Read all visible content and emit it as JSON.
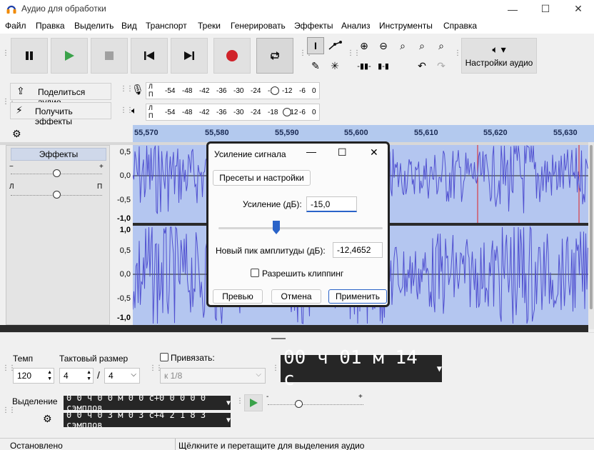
{
  "window": {
    "title": "Аудио для обработки",
    "min_icon": "minimize-icon",
    "max_icon": "maximize-icon",
    "close_icon": "close-icon"
  },
  "menu": {
    "items": [
      "Файл",
      "Правка",
      "Выделить",
      "Вид",
      "Транспорт",
      "Треки",
      "Генерировать",
      "Эффекты",
      "Анализ",
      "Инструменты",
      "Справка"
    ]
  },
  "toolbar": {
    "audio_settings_label": "Настройки аудио",
    "share_audio_label": "Поделиться аудио",
    "get_effects_label": "Получить эффекты",
    "meter_lr_top": "Л",
    "meter_lr_bottom": "П",
    "rec_meter_scale": [
      "-54",
      "-48",
      "-42",
      "-36",
      "-30",
      "-24",
      "-18",
      "-12",
      "-6",
      "0"
    ],
    "play_meter_scale": [
      "-54",
      "-48",
      "-42",
      "-36",
      "-30",
      "-24",
      "-18",
      "-12",
      "-6",
      "0"
    ]
  },
  "ruler": {
    "ticks": [
      "55,570",
      "55,580",
      "55,590",
      "55,600",
      "55,610",
      "55,620",
      "55,630"
    ]
  },
  "track": {
    "effects_button": "Эффекты",
    "gain_minus": "−",
    "gain_plus": "+",
    "pan_left": "Л",
    "pan_right": "П",
    "scale_top": [
      "0,5",
      "0,0",
      "-0,5",
      "-1,0"
    ],
    "scale_bottom": [
      "1,0",
      "0,5",
      "0,0",
      "-0,5",
      "-1,0"
    ]
  },
  "dialog": {
    "title": "Усиление сигнала",
    "presets_button": "Пресеты и настройки",
    "gain_label": "Усиление (дБ):",
    "gain_value": "-15,0",
    "slider_fraction": 0.35,
    "peak_label": "Новый пик амплитуды (дБ):",
    "peak_value": "-12,4652",
    "clipping_label": "Разрешить клиппинг",
    "preview_button": "Превью",
    "cancel_button": "Отмена",
    "apply_button": "Применить"
  },
  "bottom": {
    "tempo_label": "Темп",
    "tempo_value": "120",
    "meter_label": "Тактовый размер",
    "meter_num": "4",
    "meter_sep": "/",
    "meter_den": "4",
    "snap_label": "Привязать:",
    "snap_value": "к 1/8",
    "big_time": "00 ч 01 м 14 с",
    "selection_label": "Выделение",
    "sel_start": "0 0 ч 0 0 м 0 0 с+0 0 0 0 0 сэмплов",
    "sel_end": "0 0 ч 0 3 м 0 3 с+4 2 1 8 3 сэмплов",
    "speed_minus": "-",
    "speed_plus": "+"
  },
  "status": {
    "left": "Остановлено",
    "right": "Щёлкните и перетащите для выделения аудио"
  },
  "colors": {
    "selection": "#b4c6f0",
    "wave": "#5050d0",
    "ruler": "#b3c9ee",
    "record": "#d0232a",
    "play": "#3aa24a",
    "accent": "#2a63c8"
  }
}
